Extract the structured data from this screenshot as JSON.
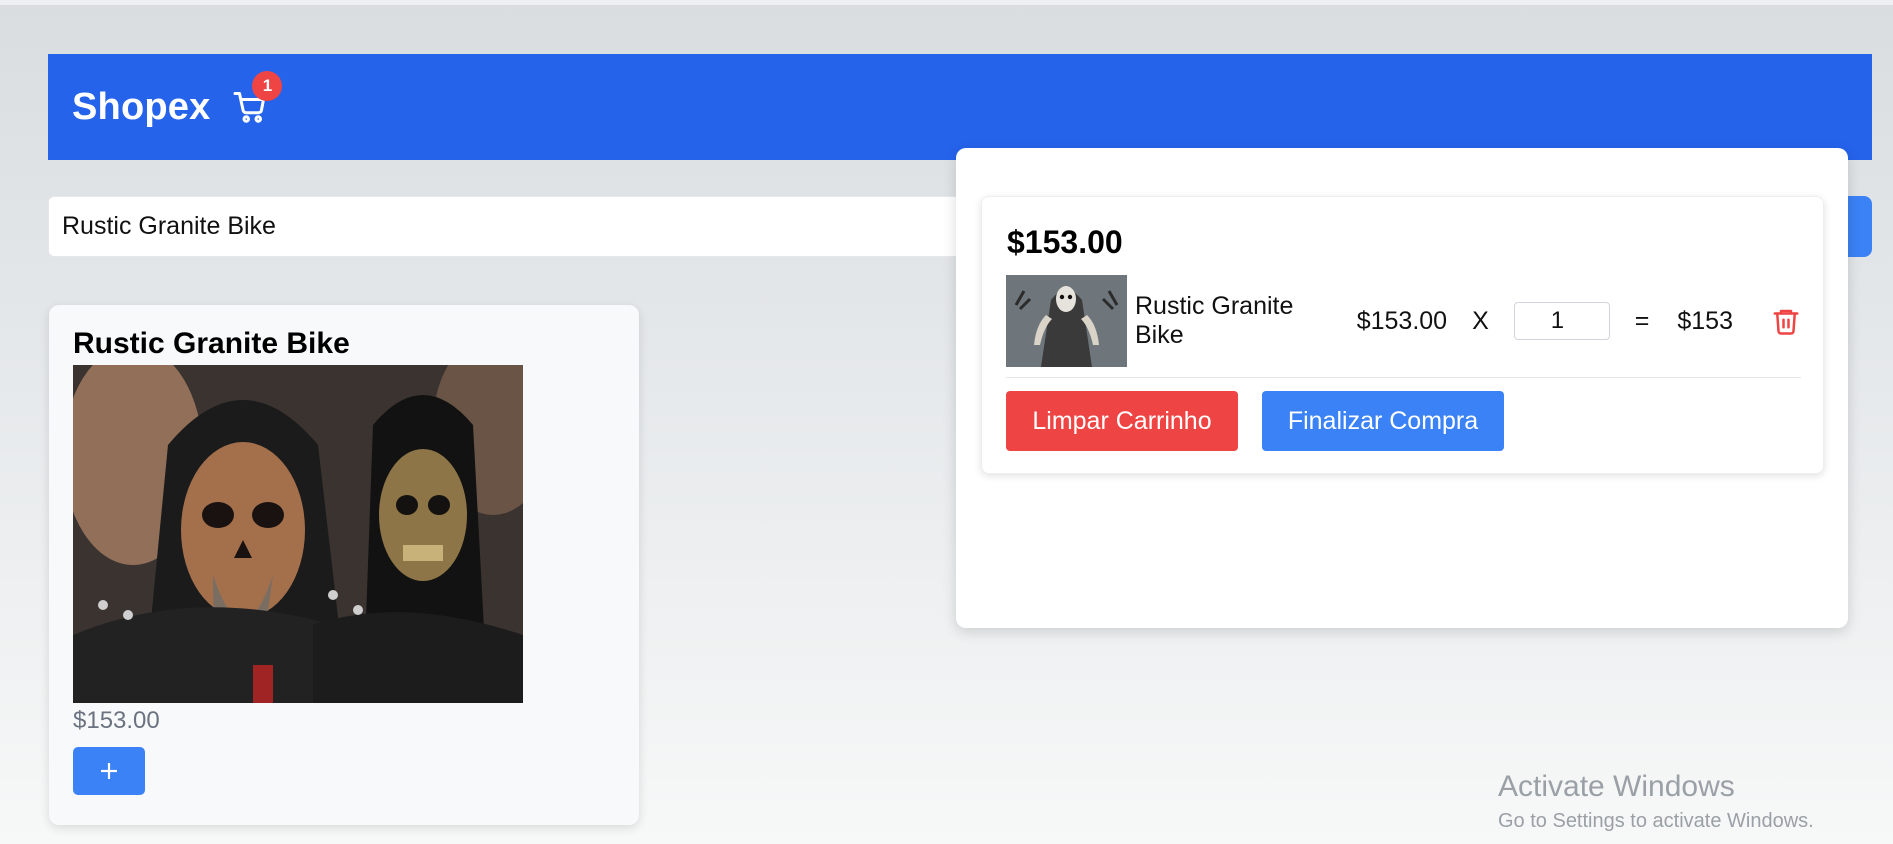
{
  "header": {
    "brand": "Shopex",
    "cart_count": "1",
    "cart_icon": "shopping-cart-icon",
    "background": "#2563eb"
  },
  "search": {
    "value": "Rustic Granite Bike"
  },
  "product": {
    "title": "Rustic Granite Bike",
    "price": "$153.00",
    "add_icon": "plus-icon"
  },
  "cart": {
    "total": "$153.00",
    "items": [
      {
        "name": "Rustic Granite Bike",
        "unit_price": "$153.00",
        "times": "X",
        "quantity": "1",
        "equals": "=",
        "line_total": "$153",
        "remove_icon": "trash-icon"
      }
    ],
    "clear_label": "Limpar Carrinho",
    "checkout_label": "Finalizar Compra"
  },
  "colors": {
    "primary": "#2563eb",
    "button_blue": "#3b82f6",
    "danger": "#ef4444",
    "muted_text": "#6b7280"
  },
  "watermark": {
    "title": "Activate Windows",
    "subtitle": "Go to Settings to activate Windows."
  }
}
